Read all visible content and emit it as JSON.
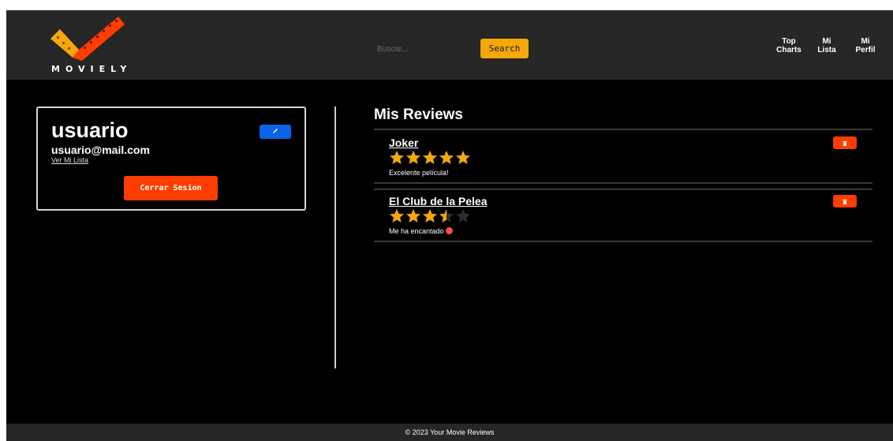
{
  "header": {
    "logo_text": "MOVIELY",
    "search": {
      "placeholder": "Buscar...",
      "value": ""
    },
    "search_button_label": "Search",
    "nav": [
      {
        "label": "Top\nCharts"
      },
      {
        "label": "Mi\nLista"
      },
      {
        "label": "Mi\nPerfil"
      }
    ]
  },
  "profile": {
    "username": "usuario",
    "email": "usuario@mail.com",
    "list_link_label": "Ver Mi Lista",
    "logout_label": "Cerrar Sesion",
    "edit_icon": "pencil-icon"
  },
  "reviews": {
    "title": "Mis Reviews",
    "items": [
      {
        "movie": "Joker",
        "rating": 5,
        "max": 5,
        "text": "Excelente película!",
        "emoji": false
      },
      {
        "movie": "El Club de la Pelea",
        "rating": 3.5,
        "max": 5,
        "text": "Me ha encantado",
        "emoji": true
      }
    ],
    "delete_icon": "trash-icon"
  },
  "footer": {
    "text": "© 2023 Your Movie Reviews"
  },
  "colors": {
    "header_bg": "#262626",
    "page_bg": "#000000",
    "accent_search": "#f5a70b",
    "danger": "#ff3d00",
    "edit": "#0b63e5",
    "star": "#f5a70b"
  }
}
